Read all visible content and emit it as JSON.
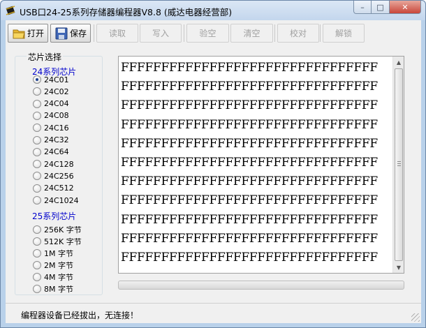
{
  "window": {
    "title": "USB口24-25系列存储器编程器V8.8 (威达电器经营部)",
    "controls": {
      "minimize": "–",
      "maximize": "□",
      "close": "✕"
    }
  },
  "toolbar": {
    "open_label": "打开",
    "save_label": "保存",
    "read_label": "读取",
    "write_label": "写入",
    "verify_label": "验空",
    "erase_label": "清空",
    "check_label": "校对",
    "unlock_label": "解锁"
  },
  "chip_select": {
    "legend": "芯片选择",
    "series24": {
      "label": "24系列芯片",
      "items": [
        "24C01",
        "24C02",
        "24C04",
        "24C08",
        "24C16",
        "24C32",
        "24C64",
        "24C128",
        "24C256",
        "24C512",
        "24C1024"
      ],
      "selected": "24C01"
    },
    "series25": {
      "label": "25系列芯片",
      "items": [
        "256K 字节",
        "512K 字节",
        "1M 字节",
        "2M 字节",
        "4M 字节",
        "8M 字节"
      ]
    }
  },
  "hex": {
    "lines": [
      "FFFFFFFFFFFFFFFFFFFFFFFFFFFFFFFF",
      "FFFFFFFFFFFFFFFFFFFFFFFFFFFFFFFF",
      "FFFFFFFFFFFFFFFFFFFFFFFFFFFFFFFF",
      "FFFFFFFFFFFFFFFFFFFFFFFFFFFFFFFF",
      "FFFFFFFFFFFFFFFFFFFFFFFFFFFFFFFF",
      "FFFFFFFFFFFFFFFFFFFFFFFFFFFFFFFF",
      "FFFFFFFFFFFFFFFFFFFFFFFFFFFFFFFF",
      "FFFFFFFFFFFFFFFFFFFFFFFFFFFFFFFF",
      "FFFFFFFFFFFFFFFFFFFFFFFFFFFFFFFF",
      "FFFFFFFFFFFFFFFFFFFFFFFFFFFFFFFF",
      "FFFFFFFFFFFFFFFFFFFFFFFFFFFFFFFF"
    ]
  },
  "progress": {
    "value_percent": 0
  },
  "status": {
    "message": "编程器设备已经拔出，无连接！"
  },
  "colors": {
    "series_label": "#0000cc",
    "title_bar": "#c3d6ed",
    "close_button": "#c9463a"
  }
}
